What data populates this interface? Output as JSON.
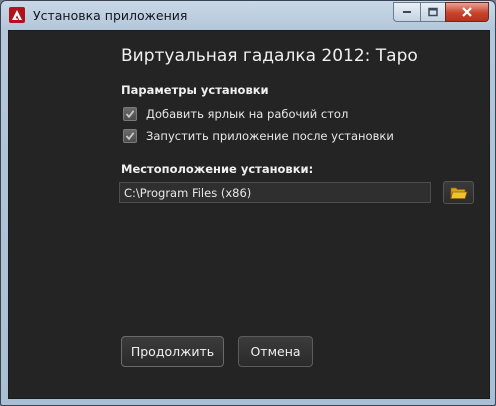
{
  "window": {
    "title": "Установка приложения",
    "controls": [
      "minimize",
      "maximize",
      "close"
    ]
  },
  "content": {
    "app_title": "Виртуальная гадалка 2012: Таро",
    "install_params_heading": "Параметры установки",
    "options": [
      {
        "label": "Добавить ярлык на рабочий стол",
        "checked": true
      },
      {
        "label": "Запустить приложение после установки",
        "checked": true
      }
    ],
    "location_heading": "Местоположение установки:",
    "install_path": "C:\\Program Files (x86)",
    "browse_icon": "folder-icon"
  },
  "buttons": {
    "continue_label": "Продолжить",
    "cancel_label": "Отмена"
  },
  "colors": {
    "client_background": "#242424",
    "text": "#f0f0f0",
    "adobe_red": "#b3121b",
    "folder_yellow": "#f2c12e"
  }
}
